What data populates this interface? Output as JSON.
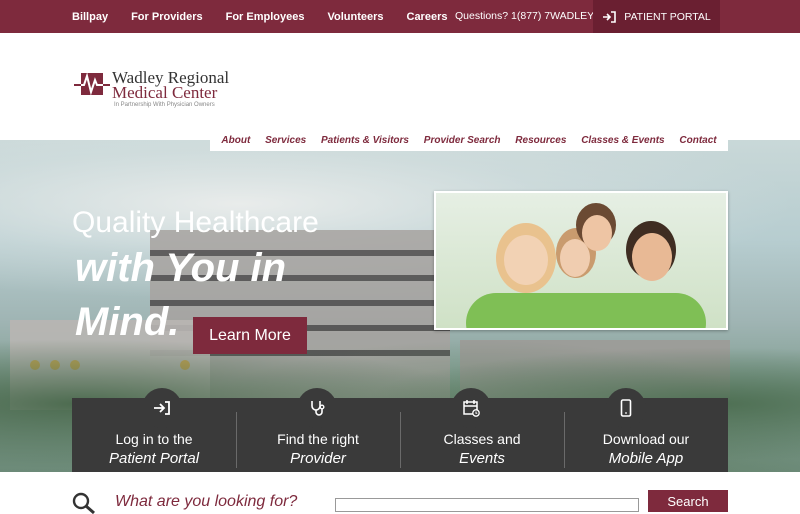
{
  "topbar": {
    "links": [
      "Billpay",
      "For Providers",
      "For Employees",
      "Volunteers",
      "Careers"
    ],
    "phone": "Questions? 1(877) 7WADLEY",
    "portal_label": "PATIENT PORTAL"
  },
  "logo": {
    "line1": "Wadley Regional",
    "line2": "Medical Center",
    "tagline": "In Partnership With Physician Owners"
  },
  "nav": {
    "items": [
      "About",
      "Services",
      "Patients & Visitors",
      "Provider Search",
      "Resources",
      "Classes & Events",
      "Contact"
    ]
  },
  "hero": {
    "title_line1": "Quality Healthcare",
    "title_line2": "with You in",
    "title_line3": "Mind.",
    "cta": "Learn More"
  },
  "quick_links": [
    {
      "line1": "Log in to the",
      "line2": "Patient Portal",
      "icon": "login-icon"
    },
    {
      "line1": "Find the right",
      "line2": "Provider",
      "icon": "stethoscope-icon"
    },
    {
      "line1": "Classes and",
      "line2": "Events",
      "icon": "calendar-icon"
    },
    {
      "line1": "Download our",
      "line2": "Mobile App",
      "icon": "mobile-phone-icon"
    }
  ],
  "search": {
    "prompt": "What are you looking for?",
    "placeholder": "",
    "button": "Search"
  },
  "colors": {
    "brand": "#7e2a3d",
    "dark_panel": "#3a3a3a"
  }
}
